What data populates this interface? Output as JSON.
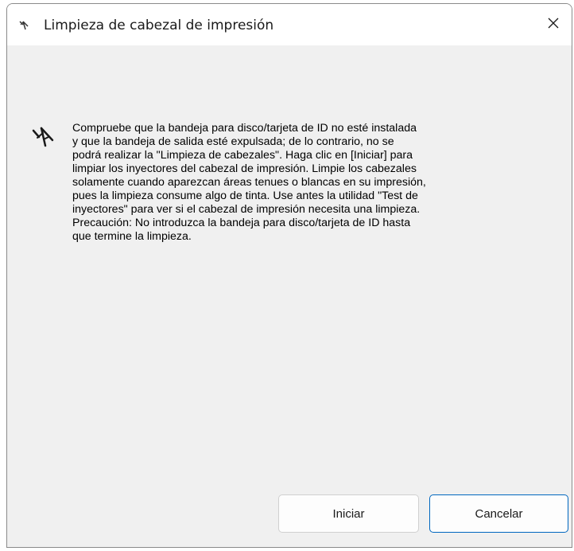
{
  "dialog": {
    "title": "Limpieza de cabezal de impresión",
    "title_icon": "printer-head-icon",
    "close_icon": "close-icon",
    "content_icon": "printer-head-icon",
    "message_lines": [
      "Compruebe que la bandeja para disco/tarjeta de ID no esté instalada",
      "y que la bandeja de salida esté expulsada; de lo contrario, no se",
      "podrá realizar la \"Limpieza de cabezales\". Haga clic en [Iniciar] para",
      "limpiar los inyectores del cabezal de impresión. Limpie los cabezales",
      "solamente cuando aparezcan áreas tenues o blancas en su impresión,",
      "pues la limpieza consume algo de tinta. Use antes la utilidad \"Test de",
      "inyectores\" para ver si el cabezal de impresión necesita una limpieza.",
      "Precaución: No introduzca la bandeja para disco/tarjeta de ID hasta",
      "que termine la limpieza."
    ],
    "buttons": {
      "start_label": "Iniciar",
      "cancel_label": "Cancelar"
    },
    "colors": {
      "body_bg": "#f0f0f0",
      "titlebar_bg": "#ffffff",
      "accent": "#0067c0"
    }
  }
}
